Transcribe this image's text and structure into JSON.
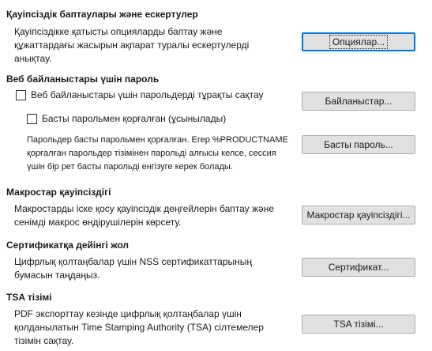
{
  "security_options": {
    "title": "Қауіпсіздік баптаулары және ескертулер",
    "desc_lines": [
      "Қауіпсіздікке қатысты опцияларды баптау және",
      "құжаттардағы жасырын ақпарат туралы ескертулерді",
      "анықтау."
    ],
    "button": "Опциялар..."
  },
  "web_passwords": {
    "title": "Веб байланыстары үшін пароль",
    "persist_checkbox": "Веб байланыстары үшін парольдерді тұрақты сақтау",
    "persist_checked": false,
    "connections_button": "Байланыстар...",
    "master_checkbox": "Басты парольмен қорғалған (ұсынылады)",
    "master_checked": false,
    "master_desc_lines": [
      "Парольдер басты парольмен қорғалған. Егер %PRODUCTNAME",
      "қорғалған парольдер тізімінен парольді алғысы келсе, сессия",
      "үшін бір рет басты парольді енгізуге керек болады."
    ],
    "master_button": "Басты пароль..."
  },
  "macro_security": {
    "title": "Макростар қауіпсіздігі",
    "desc_lines": [
      "Макростарды іске қосу қауіпсіздік деңгейлерін баптау және",
      "сенімді макрос өндірушілерін көрсету."
    ],
    "button": "Макростар қауіпсіздігі..."
  },
  "certificate_path": {
    "title": "Сертификатқа дейінгі жол",
    "desc_lines": [
      "Цифрлық қолтаңбалар үшін NSS сертификаттарының",
      "бумасын таңдаңыз."
    ],
    "button": "Сертификат..."
  },
  "tsa_list": {
    "title": "TSA тізімі",
    "desc_lines": [
      "PDF экспорттау кезінде цифрлық қолтаңбалар үшін",
      "қолданылатын Time Stamping Authority (TSA) сілтемелер",
      "тізімін сақтау."
    ],
    "button": "TSA тізімі..."
  }
}
